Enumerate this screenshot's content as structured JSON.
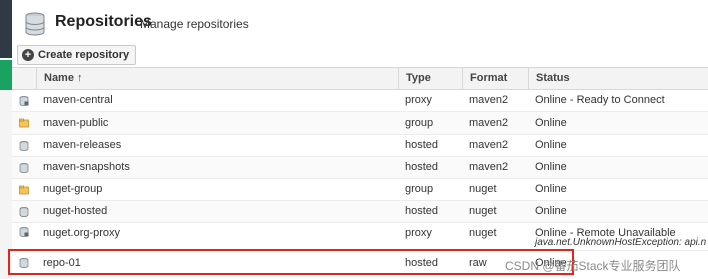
{
  "header": {
    "title": "Repositories",
    "subtitle": "Manage repositories"
  },
  "toolbar": {
    "create_label": "Create repository"
  },
  "columns": {
    "name": "Name ↑",
    "type": "Type",
    "format": "Format",
    "status": "Status"
  },
  "rows": [
    {
      "name": "maven-central",
      "type": "proxy",
      "format": "maven2",
      "status": "Online - Ready to Connect",
      "icon": "proxy-repo-icon"
    },
    {
      "name": "maven-public",
      "type": "group",
      "format": "maven2",
      "status": "Online",
      "icon": "group-repo-icon"
    },
    {
      "name": "maven-releases",
      "type": "hosted",
      "format": "maven2",
      "status": "Online",
      "icon": "hosted-repo-icon"
    },
    {
      "name": "maven-snapshots",
      "type": "hosted",
      "format": "maven2",
      "status": "Online",
      "icon": "hosted-repo-icon"
    },
    {
      "name": "nuget-group",
      "type": "group",
      "format": "nuget",
      "status": "Online",
      "icon": "group-repo-icon"
    },
    {
      "name": "nuget-hosted",
      "type": "hosted",
      "format": "nuget",
      "status": "Online",
      "icon": "hosted-repo-icon"
    },
    {
      "name": "nuget.org-proxy",
      "type": "proxy",
      "format": "nuget",
      "status": "Online - Remote Unavailable",
      "status_detail": "java.net.UnknownHostException: api.n",
      "icon": "proxy-repo-icon"
    },
    {
      "name": "repo-01",
      "type": "hosted",
      "format": "raw",
      "status": "Online",
      "icon": "hosted-repo-icon"
    }
  ],
  "watermark": "CSDN @番茄Stack专业服务团队",
  "colors": {
    "highlight": "#e0261c",
    "nav_green": "#1aa260",
    "header_bg": "#f3f3f3"
  }
}
